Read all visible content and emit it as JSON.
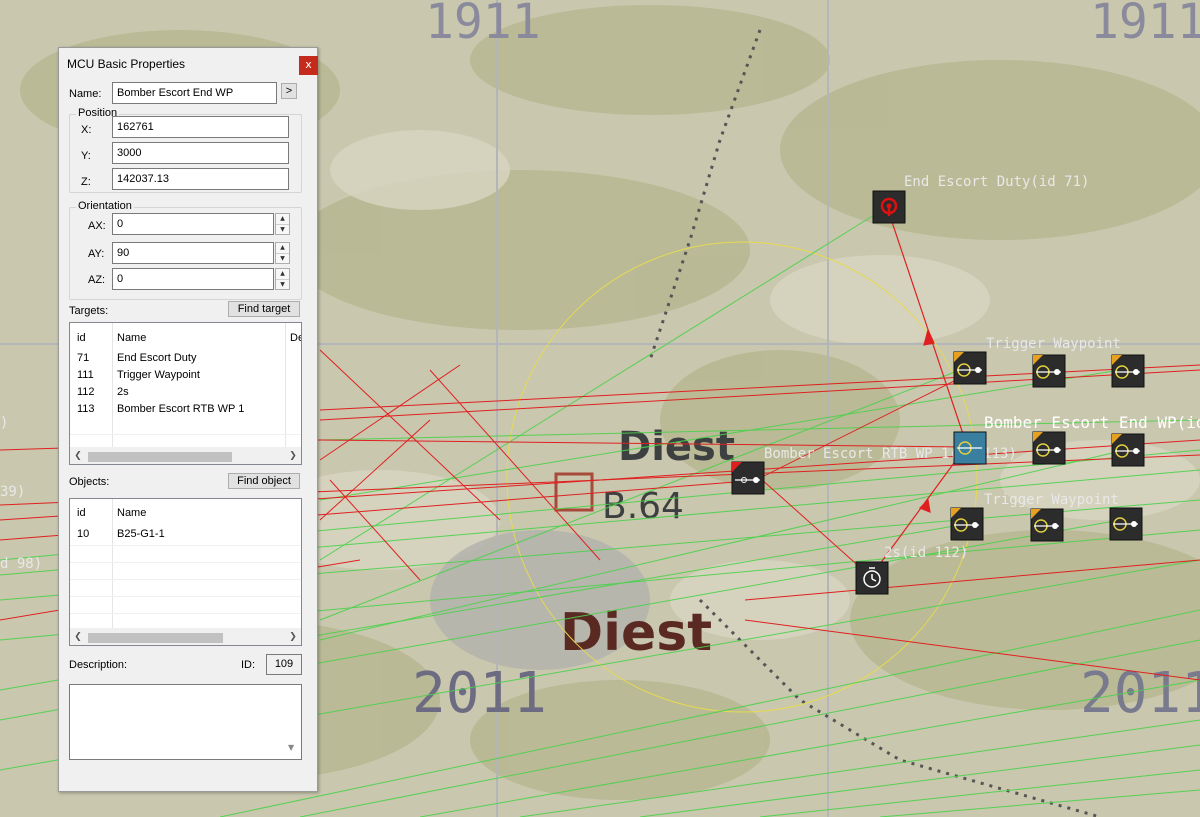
{
  "map": {
    "grid_numbers": [
      "1911",
      "1911",
      "2011",
      "2011"
    ],
    "town_label": "Diest",
    "sub_label": "B.64",
    "node_labels": {
      "end_escort": "End Escort Duty(id 71)",
      "trigger_wp_1": "Trigger Waypoint",
      "trigger_wp_2": "Trigger Waypoint",
      "bomber_escort_end": "Bomber Escort End WP(id",
      "bomber_escort_rtb": "Bomber Escort RTB WP 1(id 113)",
      "timer": "2s(id 112)",
      "edge_left_1": "39)",
      "edge_left_2": "d 98)",
      "edge_left_3": ")"
    }
  },
  "dialog": {
    "title": "MCU Basic Properties",
    "close_label": "x",
    "name_label": "Name:",
    "name_value": "Bomber Escort End WP",
    "name_btn": ">",
    "position": {
      "title": "Position",
      "x_label": "X:",
      "x_value": "162761",
      "y_label": "Y:",
      "y_value": "3000",
      "z_label": "Z:",
      "z_value": "142037.13"
    },
    "orientation": {
      "title": "Orientation",
      "ax_label": "AX:",
      "ax_value": "0",
      "ay_label": "AY:",
      "ay_value": "90",
      "az_label": "AZ:",
      "az_value": "0"
    },
    "targets": {
      "label": "Targets:",
      "find_btn": "Find target",
      "columns": [
        "id",
        "Name",
        "De"
      ],
      "rows": [
        {
          "id": "71",
          "name": "End Escort Duty"
        },
        {
          "id": "111",
          "name": "Trigger Waypoint"
        },
        {
          "id": "112",
          "name": "2s"
        },
        {
          "id": "113",
          "name": "Bomber Escort RTB WP 1"
        }
      ]
    },
    "objects": {
      "label": "Objects:",
      "find_btn": "Find object",
      "columns": [
        "id",
        "Name"
      ],
      "rows": [
        {
          "id": "10",
          "name": "B25-G1-1"
        }
      ]
    },
    "description_label": "Description:",
    "id_label": "ID:",
    "id_value": "109",
    "description_value": ""
  }
}
